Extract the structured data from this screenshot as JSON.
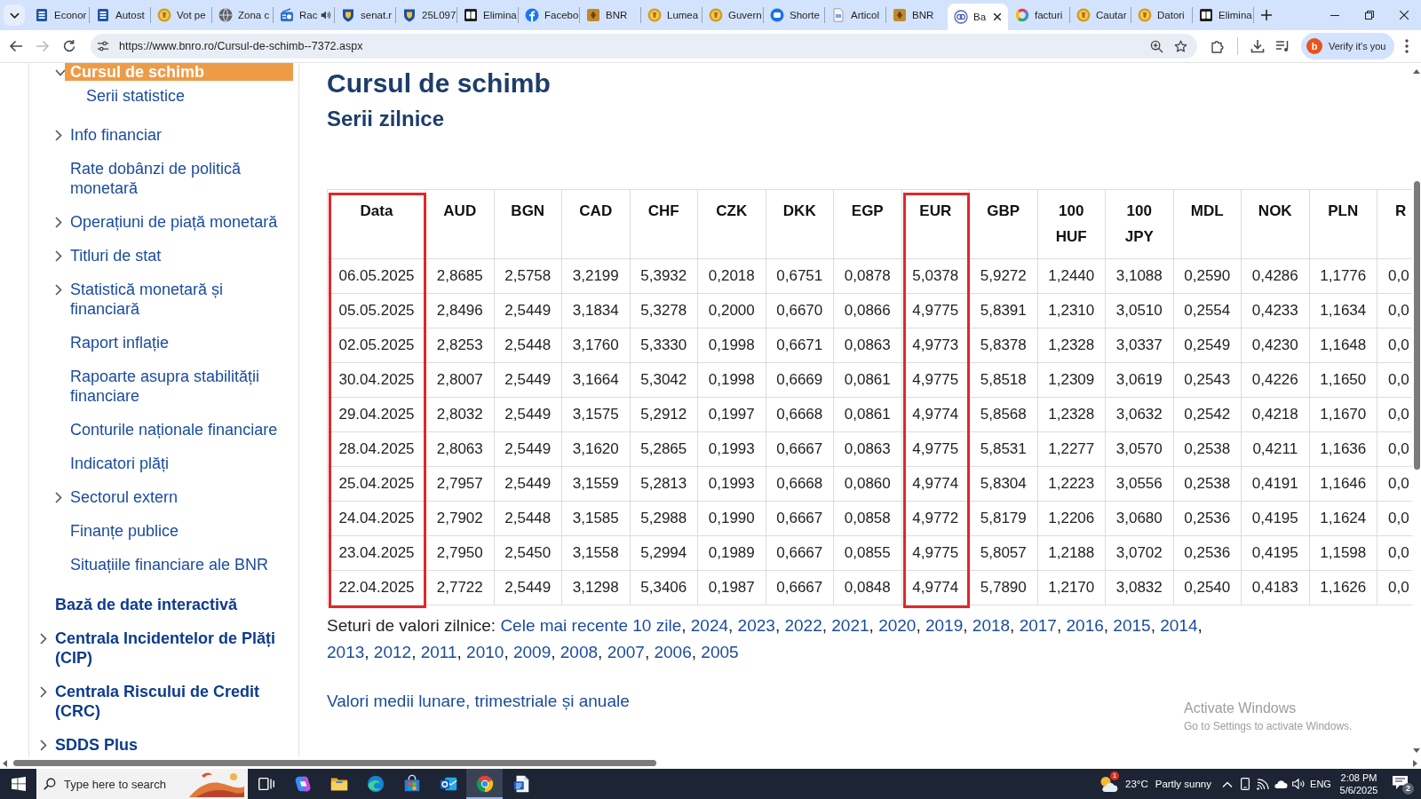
{
  "browser": {
    "tabs": [
      {
        "title": "Econor",
        "kind": "lines",
        "audio": false,
        "selected": false
      },
      {
        "title": "Autost",
        "kind": "lines",
        "audio": false,
        "selected": false
      },
      {
        "title": "Vot pe",
        "kind": "coin",
        "audio": false,
        "selected": false
      },
      {
        "title": "Zona c",
        "kind": "globe",
        "audio": false,
        "selected": false
      },
      {
        "title": "Rac",
        "kind": "radio",
        "audio": true,
        "selected": false
      },
      {
        "title": "senat.r",
        "kind": "crest",
        "audio": false,
        "selected": false
      },
      {
        "title": "25L097",
        "kind": "crest",
        "audio": false,
        "selected": false
      },
      {
        "title": "Elimina",
        "kind": "tile",
        "audio": false,
        "selected": false
      },
      {
        "title": "Facebo",
        "kind": "social",
        "audio": false,
        "selected": false
      },
      {
        "title": "BNR",
        "kind": "emblem",
        "audio": false,
        "selected": false
      },
      {
        "title": "Lumea",
        "kind": "coin",
        "audio": false,
        "selected": false
      },
      {
        "title": "Guvern",
        "kind": "coin",
        "audio": false,
        "selected": false
      },
      {
        "title": "Shorte",
        "kind": "ring",
        "audio": false,
        "selected": false
      },
      {
        "title": "Articol",
        "kind": "page",
        "audio": false,
        "selected": false
      },
      {
        "title": "BNR",
        "kind": "emblem",
        "audio": false,
        "selected": false
      },
      {
        "title": "Ba",
        "kind": "monogram",
        "audio": false,
        "selected": true
      },
      {
        "title": "facturi",
        "kind": "search",
        "audio": false,
        "selected": false
      },
      {
        "title": "Cautar",
        "kind": "coin",
        "audio": false,
        "selected": false
      },
      {
        "title": "Datori",
        "kind": "coin",
        "audio": false,
        "selected": false
      },
      {
        "title": "Elimina",
        "kind": "tile",
        "audio": false,
        "selected": false
      }
    ],
    "navigation": [
      {
        "kind": "back",
        "disabled": false
      },
      {
        "kind": "forward",
        "disabled": true
      },
      {
        "kind": "reload",
        "disabled": false
      }
    ],
    "url": "https://www.bnro.ro/Cursul-de-schimb--7372.aspx",
    "profile": {
      "initial": "b",
      "label": "Verify it's you"
    }
  },
  "sidebar": {
    "subitems": [
      {
        "label": "Cursul de schimb",
        "kind": "group",
        "expanded": true,
        "selected": true,
        "children": [
          {
            "label": "Serii statistice",
            "expanded": false,
            "selected": false
          }
        ]
      },
      {
        "label": "Info financiar",
        "kind": "group",
        "expanded": false,
        "selected": false
      },
      {
        "label": "Rate dobânzi de politică monetară",
        "kind": "link",
        "expanded": false,
        "selected": false
      },
      {
        "label": "Operațiuni de piață monetară",
        "kind": "group",
        "expanded": false,
        "selected": false
      },
      {
        "label": "Titluri de stat",
        "kind": "group",
        "expanded": false,
        "selected": false
      },
      {
        "label": "Statistică monetară și financiară",
        "kind": "group",
        "expanded": false,
        "selected": false
      },
      {
        "label": "Raport inflație",
        "kind": "link",
        "expanded": false,
        "selected": false
      },
      {
        "label": "Rapoarte asupra stabilității financiare",
        "kind": "link",
        "expanded": false,
        "selected": false
      },
      {
        "label": "Conturile naționale financiare",
        "kind": "link",
        "expanded": false,
        "selected": false
      },
      {
        "label": "Indicatori plăți",
        "kind": "link",
        "expanded": false,
        "selected": false
      },
      {
        "label": "Sectorul extern",
        "kind": "group",
        "expanded": false,
        "selected": false
      },
      {
        "label": "Finanțe publice",
        "kind": "link",
        "expanded": false,
        "selected": false
      },
      {
        "label": "Situațiile financiare ale BNR",
        "kind": "link",
        "expanded": false,
        "selected": false
      }
    ],
    "items": [
      {
        "label": "Bază de date interactivă",
        "kind": "link",
        "expanded": false,
        "selected": false
      },
      {
        "label": "Centrala Incidentelor de Plăți (CIP)",
        "kind": "group",
        "expanded": false,
        "selected": false
      },
      {
        "label": "Centrala Riscului de Credit (CRC)",
        "kind": "group",
        "expanded": false,
        "selected": false
      },
      {
        "label": "SDDS Plus",
        "kind": "group",
        "expanded": false,
        "selected": false
      }
    ]
  },
  "content": {
    "title": "Cursul de schimb",
    "subtitle": "Serii zilnice",
    "table": {
      "columns": [
        {
          "label": "Data",
          "highlighted": true
        },
        {
          "label": "AUD",
          "highlighted": false
        },
        {
          "label": "BGN",
          "highlighted": false
        },
        {
          "label": "CAD",
          "highlighted": false
        },
        {
          "label": "CHF",
          "highlighted": false
        },
        {
          "label": "CZK",
          "highlighted": false
        },
        {
          "label": "DKK",
          "highlighted": false
        },
        {
          "label": "EGP",
          "highlighted": false
        },
        {
          "label": "EUR",
          "highlighted": true
        },
        {
          "label": "GBP",
          "highlighted": false
        },
        {
          "label": "100 HUF",
          "highlighted": false
        },
        {
          "label": "100 JPY",
          "highlighted": false
        },
        {
          "label": "MDL",
          "highlighted": false
        },
        {
          "label": "NOK",
          "highlighted": false
        },
        {
          "label": "PLN",
          "highlighted": false
        },
        {
          "label": "R",
          "highlighted": false
        }
      ],
      "rows": [
        [
          "06.05.2025",
          "2,8685",
          "2,5758",
          "3,2199",
          "5,3932",
          "0,2018",
          "0,6751",
          "0,0878",
          "5,0378",
          "5,9272",
          "1,2440",
          "3,1088",
          "0,2590",
          "0,4286",
          "1,1776",
          "0,0"
        ],
        [
          "05.05.2025",
          "2,8496",
          "2,5449",
          "3,1834",
          "5,3278",
          "0,2000",
          "0,6670",
          "0,0866",
          "4,9775",
          "5,8391",
          "1,2310",
          "3,0510",
          "0,2554",
          "0,4233",
          "1,1634",
          "0,0"
        ],
        [
          "02.05.2025",
          "2,8253",
          "2,5448",
          "3,1760",
          "5,3330",
          "0,1998",
          "0,6671",
          "0,0863",
          "4,9773",
          "5,8378",
          "1,2328",
          "3,0337",
          "0,2549",
          "0,4230",
          "1,1648",
          "0,0"
        ],
        [
          "30.04.2025",
          "2,8007",
          "2,5449",
          "3,1664",
          "5,3042",
          "0,1998",
          "0,6669",
          "0,0861",
          "4,9775",
          "5,8518",
          "1,2309",
          "3,0619",
          "0,2543",
          "0,4226",
          "1,1650",
          "0,0"
        ],
        [
          "29.04.2025",
          "2,8032",
          "2,5449",
          "3,1575",
          "5,2912",
          "0,1997",
          "0,6668",
          "0,0861",
          "4,9774",
          "5,8568",
          "1,2328",
          "3,0632",
          "0,2542",
          "0,4218",
          "1,1670",
          "0,0"
        ],
        [
          "28.04.2025",
          "2,8063",
          "2,5449",
          "3,1620",
          "5,2865",
          "0,1993",
          "0,6667",
          "0,0863",
          "4,9775",
          "5,8531",
          "1,2277",
          "3,0570",
          "0,2538",
          "0,4211",
          "1,1636",
          "0,0"
        ],
        [
          "25.04.2025",
          "2,7957",
          "2,5449",
          "3,1559",
          "5,2813",
          "0,1993",
          "0,6668",
          "0,0860",
          "4,9774",
          "5,8304",
          "1,2223",
          "3,0556",
          "0,2538",
          "0,4191",
          "1,1646",
          "0,0"
        ],
        [
          "24.04.2025",
          "2,7902",
          "2,5448",
          "3,1585",
          "5,2988",
          "0,1990",
          "0,6667",
          "0,0858",
          "4,9772",
          "5,8179",
          "1,2206",
          "3,0680",
          "0,2536",
          "0,4195",
          "1,1624",
          "0,0"
        ],
        [
          "23.04.2025",
          "2,7950",
          "2,5450",
          "3,1558",
          "5,2994",
          "0,1989",
          "0,6667",
          "0,0855",
          "4,9775",
          "5,8057",
          "1,2188",
          "3,0702",
          "0,2536",
          "0,4195",
          "1,1598",
          "0,0"
        ],
        [
          "22.04.2025",
          "2,7722",
          "2,5449",
          "3,1298",
          "5,3406",
          "0,1987",
          "0,6667",
          "0,0848",
          "4,9774",
          "5,7890",
          "1,2170",
          "3,0832",
          "0,2540",
          "0,4183",
          "1,1626",
          "0,0"
        ]
      ]
    },
    "daily_sets": {
      "label": "Seturi de valori zilnice:",
      "separator": ",",
      "links": [
        "Cele mai recente 10 zile",
        "2024",
        "2023",
        "2022",
        "2021",
        "2020",
        "2019",
        "2018",
        "2017",
        "2016",
        "2015",
        "2014",
        "2013",
        "2012",
        "2011",
        "2010",
        "2009",
        "2008",
        "2007",
        "2006",
        "2005"
      ]
    },
    "averages_link": "Valori medii lunare, trimestriale și anuale"
  },
  "os_notice": {
    "title": "Activate Windows",
    "subtitle": "Go to Settings to activate Windows."
  },
  "taskbar": {
    "search": {
      "placeholder": "Type here to search"
    },
    "apps": [
      {
        "kind": "task-view",
        "selected": false
      },
      {
        "kind": "assistant",
        "selected": false
      },
      {
        "kind": "files",
        "selected": false
      },
      {
        "kind": "edge",
        "selected": false
      },
      {
        "kind": "store",
        "selected": false
      },
      {
        "kind": "mail",
        "selected": false
      },
      {
        "kind": "chrome",
        "selected": true
      },
      {
        "kind": "document",
        "selected": false
      }
    ],
    "weather": {
      "alert": "1",
      "temperature": "23°C",
      "condition": "Partly sunny"
    },
    "language": "ENG",
    "time": "2:08 PM",
    "date": "5/6/2025",
    "notifications": "2"
  }
}
